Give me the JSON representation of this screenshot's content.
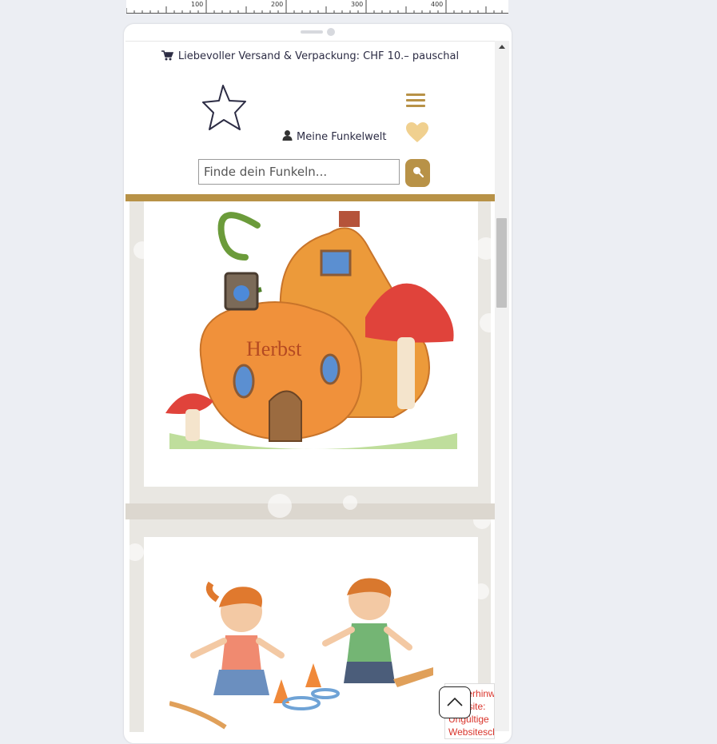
{
  "ruler": {
    "marks": [
      "100",
      "200",
      "300",
      "400"
    ]
  },
  "shop": {
    "shipping_notice": "Liebevoller Versand & Verpackung: CHF 10.– pauschal",
    "account_label": "Meine Funkelwelt",
    "search_placeholder": "Finde dein Funkeln...",
    "accent_color": "#b89247"
  },
  "images": {
    "card1_text": "Herbst"
  },
  "error_notice": {
    "text": "Fehlerhinweis Website: Ungültige Websiteschlüssel"
  },
  "icons": {
    "cart": "cart-icon",
    "logo": "star-icon",
    "menu": "hamburger-icon",
    "user": "user-icon",
    "heart": "heart-icon",
    "search": "search-icon",
    "to_top": "chevron-up-icon"
  }
}
